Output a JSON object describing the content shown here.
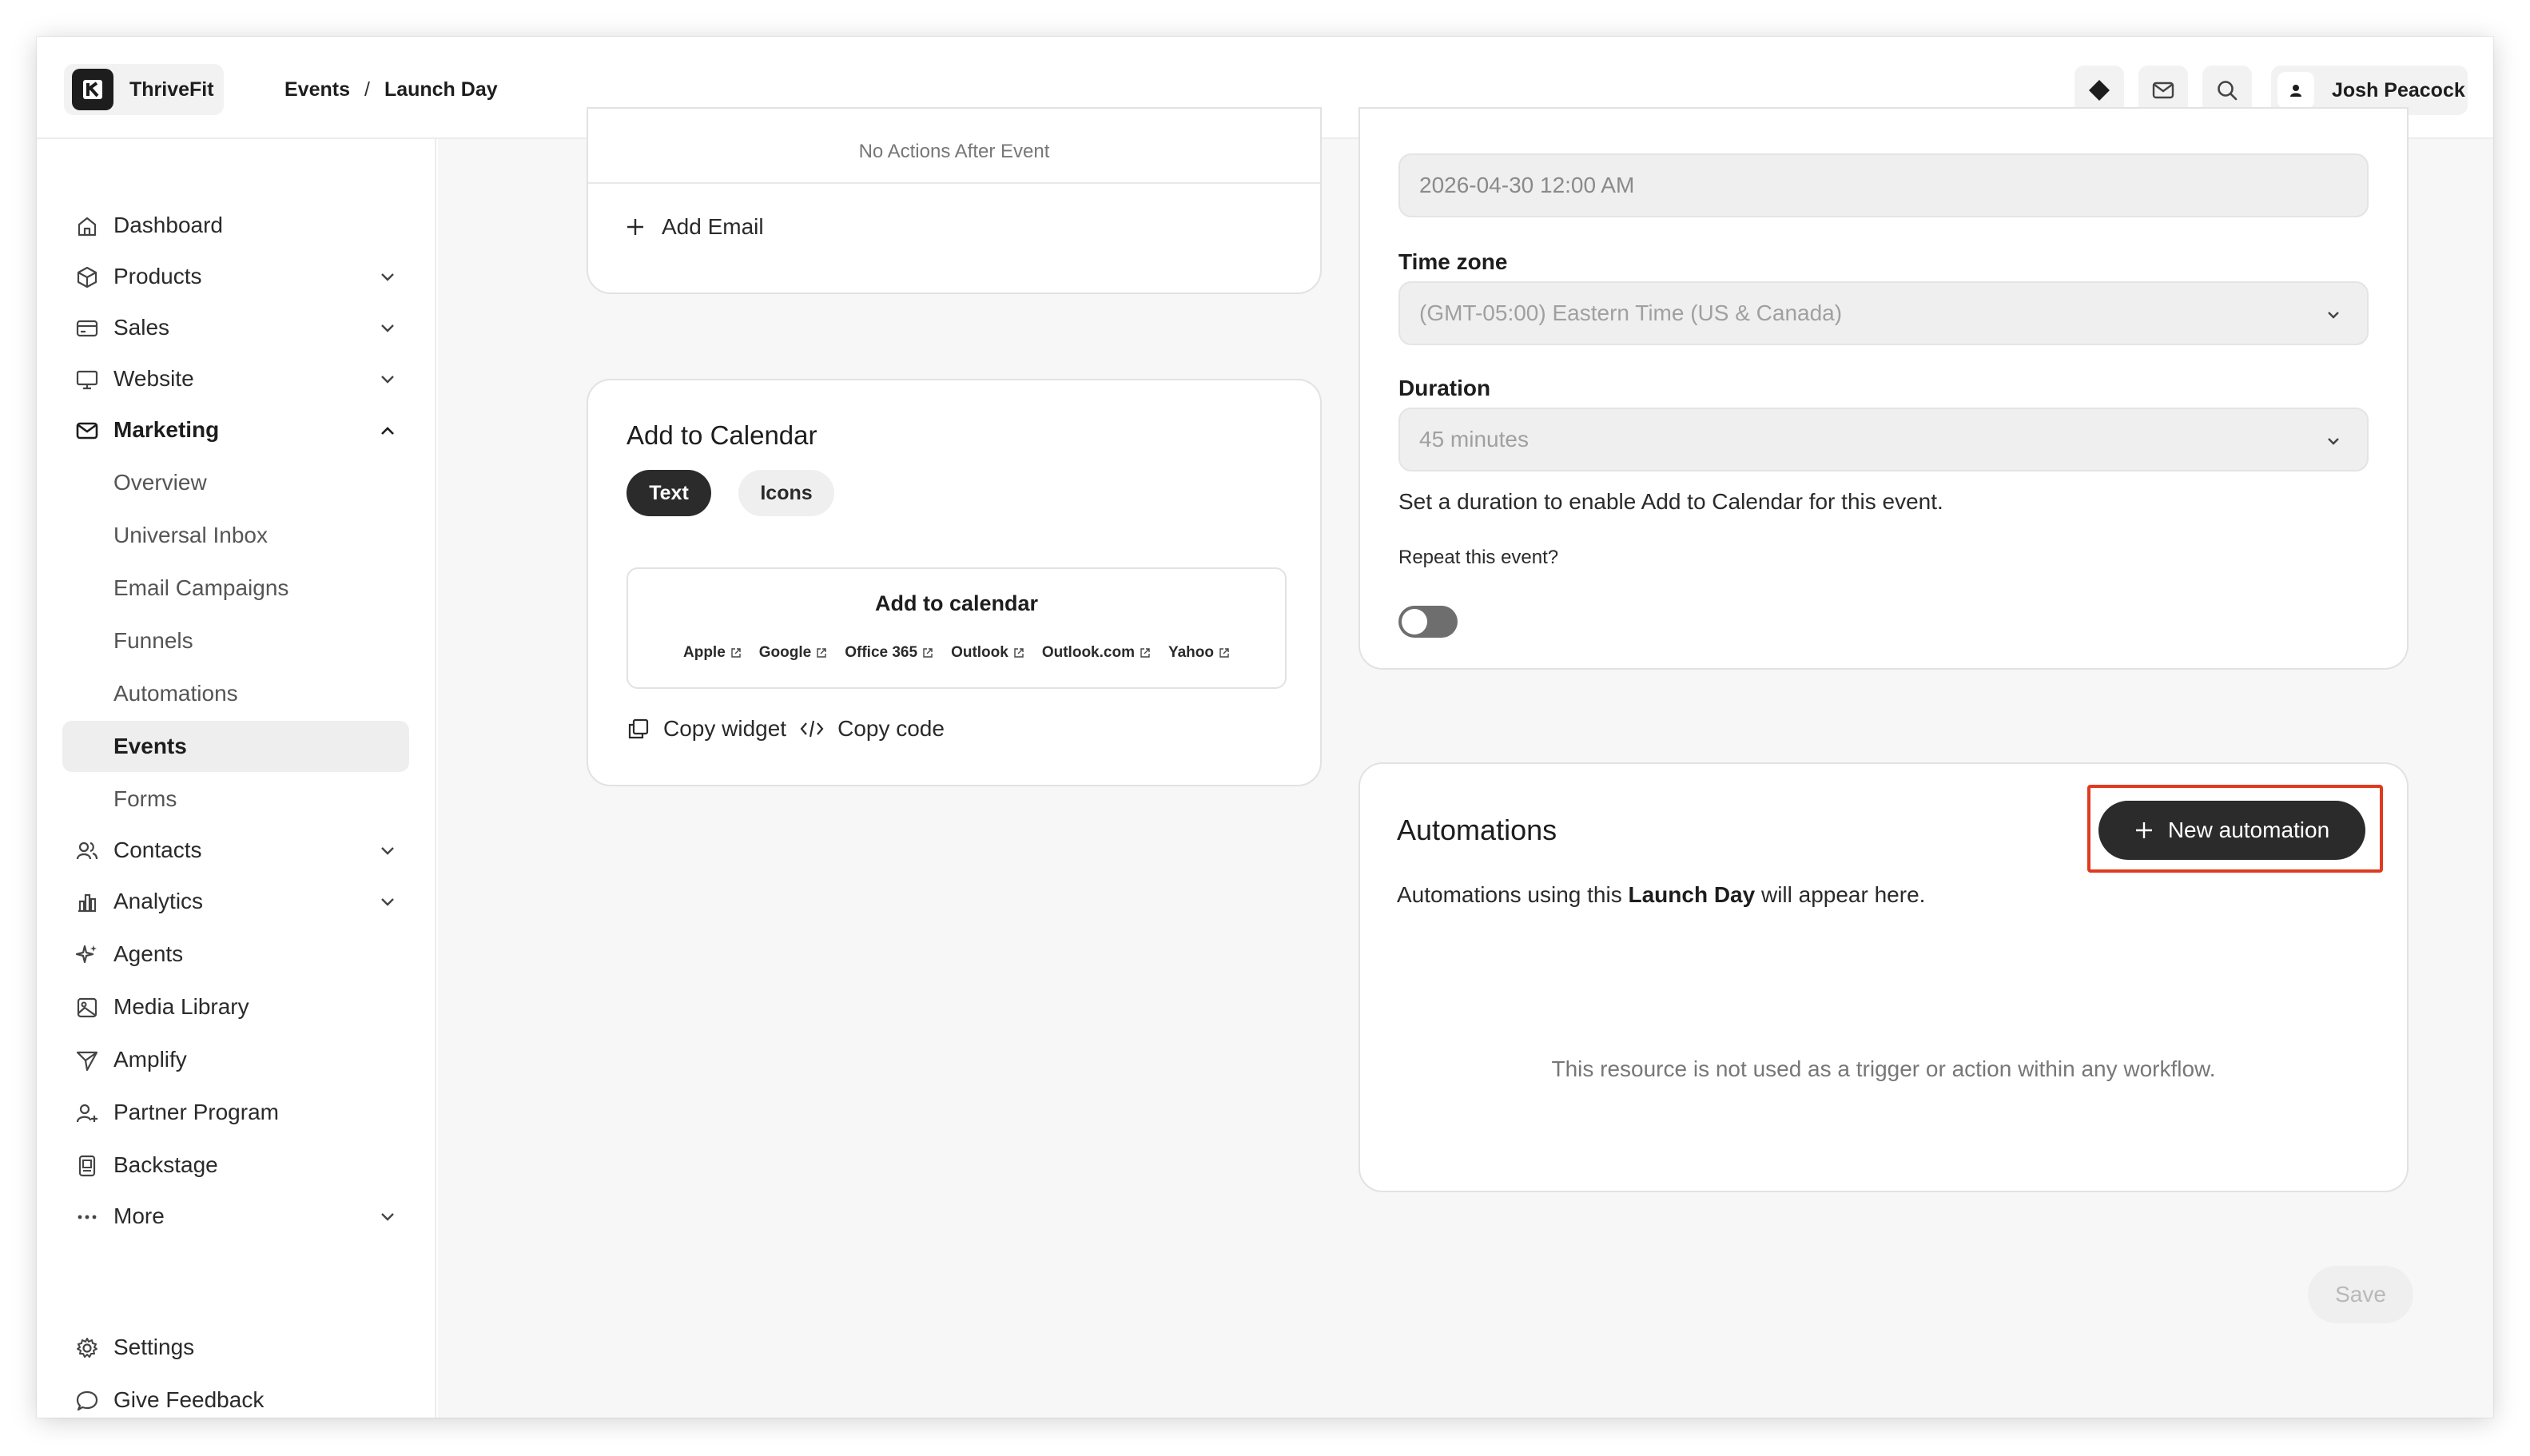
{
  "brand": {
    "name": "ThriveFit"
  },
  "breadcrumb": {
    "parent": "Events",
    "separator": "/",
    "current": "Launch Day"
  },
  "header": {
    "user_name": "Josh Peacock"
  },
  "sidebar": {
    "items": [
      {
        "label": "Dashboard"
      },
      {
        "label": "Products"
      },
      {
        "label": "Sales"
      },
      {
        "label": "Website"
      },
      {
        "label": "Marketing"
      },
      {
        "label": "Contacts"
      },
      {
        "label": "Analytics"
      },
      {
        "label": "Agents"
      },
      {
        "label": "Media Library"
      },
      {
        "label": "Amplify"
      },
      {
        "label": "Partner Program"
      },
      {
        "label": "Backstage"
      },
      {
        "label": "More"
      }
    ],
    "marketing_sub": [
      {
        "label": "Overview"
      },
      {
        "label": "Universal Inbox"
      },
      {
        "label": "Email Campaigns"
      },
      {
        "label": "Funnels"
      },
      {
        "label": "Automations"
      },
      {
        "label": "Events"
      },
      {
        "label": "Forms"
      }
    ],
    "footer": [
      {
        "label": "Settings"
      },
      {
        "label": "Give Feedback"
      }
    ]
  },
  "email_card": {
    "no_actions": "No Actions After Event",
    "add_email": "Add Email"
  },
  "calendar_card": {
    "title": "Add to Calendar",
    "tabs": [
      "Text",
      "Icons"
    ],
    "preview_title": "Add to calendar",
    "links": [
      "Apple",
      "Google",
      "Office 365",
      "Outlook",
      "Outlook.com",
      "Yahoo"
    ],
    "copy_widget": "Copy widget",
    "copy_code": "Copy code"
  },
  "schedule_card": {
    "start_value": "2026-04-30 12:00 AM",
    "timezone_label": "Time zone",
    "timezone_value": "(GMT-05:00) Eastern Time (US & Canada)",
    "duration_label": "Duration",
    "duration_value": "45 minutes",
    "duration_help": "Set a duration to enable Add to Calendar for this event.",
    "repeat_label": "Repeat this event?",
    "repeat_enabled": false
  },
  "automations_card": {
    "title": "Automations",
    "new_button": "New automation",
    "desc_prefix": "Automations using this ",
    "desc_name": "Launch Day",
    "desc_suffix": " will appear here.",
    "empty_text": "This resource is not used as a trigger or action within any workflow."
  },
  "actions": {
    "save": "Save"
  },
  "colors": {
    "highlight": "#e03a1f",
    "primary_button": "#2b2b2b",
    "active_nav": "#eeeeee"
  }
}
